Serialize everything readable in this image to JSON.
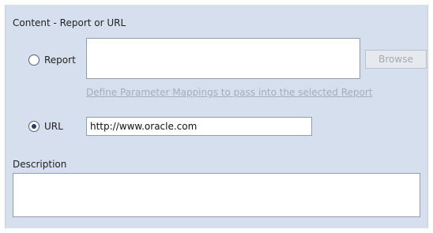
{
  "section": {
    "title": "Content - Report or URL"
  },
  "report_option": {
    "label": "Report",
    "selected": false,
    "field_value": "",
    "browse_label": "Browse",
    "browse_enabled": false,
    "mappings_link": "Define Parameter Mappings to pass into the selected Report"
  },
  "url_option": {
    "label": "URL",
    "selected": true,
    "field_value": "http://www.oracle.com"
  },
  "description": {
    "label": "Description",
    "value": ""
  },
  "colors": {
    "panel_background": "#d6dfed",
    "disabled_text": "#a2adbd",
    "radio_dot": "#1f3f6b"
  }
}
